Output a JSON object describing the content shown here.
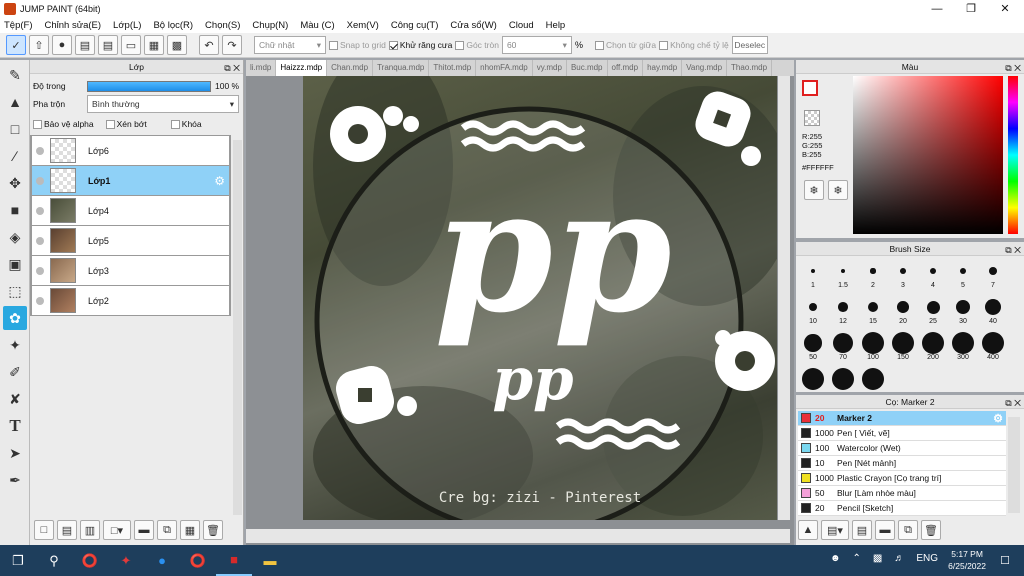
{
  "window": {
    "title": "JUMP PAINT (64bit)"
  },
  "menu": [
    "Tệp(F)",
    "Chỉnh sửa(E)",
    "Lớp(L)",
    "Bộ lọc(R)",
    "Chọn(S)",
    "Chụp(N)",
    "Màu (C)",
    "Xem(V)",
    "Công cụ(T)",
    "Cửa sổ(W)",
    "Cloud",
    "Help"
  ],
  "toolbar": {
    "shape_select": "Chữ nhật",
    "snap_grid": "Snap to grid",
    "antialias": "Khử răng cưa",
    "round_corner": "Góc tròn",
    "round_value": "60",
    "percent": "%",
    "center_select": "Chọn từ giữa",
    "lock_ratio": "Không chế tỷ lệ",
    "deselect": "Deselec"
  },
  "layer_panel": {
    "title": "Lớp",
    "opacity_label": "Độ trong",
    "opacity_value": "100 %",
    "blend_label": "Pha trộn",
    "blend_value": "Bình thường",
    "protect_alpha": "Bảo vệ alpha",
    "clipping": "Xén bớt",
    "lock": "Khóa",
    "layers": [
      {
        "name": "Lớp6",
        "selected": false
      },
      {
        "name": "Lớp1",
        "selected": true
      },
      {
        "name": "Lớp4",
        "selected": false
      },
      {
        "name": "Lớp5",
        "selected": false
      },
      {
        "name": "Lớp3",
        "selected": false
      },
      {
        "name": "Lớp2",
        "selected": false
      }
    ]
  },
  "tabs": [
    "li.mdp",
    "Haizzz.mdp",
    "Chan.mdp",
    "Tranqua.mdp",
    "Thitot.mdp",
    "nhomFA.mdp",
    "vy.mdp",
    "Buc.mdp",
    "off.mdp",
    "hay.mdp",
    "Vang.mdp",
    "Thao.mdp"
  ],
  "active_tab": "Haizzz.mdp",
  "canvas": {
    "big_text": "pp",
    "small_text": "pp",
    "credit": "Cre bg: zizi - Pinterest"
  },
  "color_panel": {
    "title": "Màu",
    "r": "R:255",
    "g": "G:255",
    "b": "B:255",
    "hex": "#FFFFFF"
  },
  "brush_panel": {
    "title": "Brush Size",
    "sizes": [
      "1",
      "1.5",
      "2",
      "3",
      "4",
      "5",
      "7",
      "10",
      "12",
      "15",
      "20",
      "25",
      "30",
      "40",
      "50",
      "70",
      "100",
      "150",
      "200",
      "300",
      "400"
    ]
  },
  "marker_panel": {
    "title": "Cọ: Marker 2",
    "items": [
      {
        "size": "20",
        "name": "Marker 2",
        "color": "#e8303a",
        "selected": true
      },
      {
        "size": "1000",
        "name": "Pen [ Viết, vẽ]",
        "color": "#222222",
        "selected": false
      },
      {
        "size": "100",
        "name": "Watercolor (Wet)",
        "color": "#7ad8f0",
        "selected": false
      },
      {
        "size": "10",
        "name": "Pen [Nét mảnh]",
        "color": "#222222",
        "selected": false
      },
      {
        "size": "1000",
        "name": "Plastic Crayon [Cọ trang trí]",
        "color": "#f0e020",
        "selected": false
      },
      {
        "size": "50",
        "name": "Blur [Làm nhòe màu]",
        "color": "#f4a0d8",
        "selected": false
      },
      {
        "size": "20",
        "name": "Pencil [Sketch]",
        "color": "#222222",
        "selected": false
      }
    ]
  },
  "taskbar": {
    "lang": "ENG",
    "time": "5:17 PM",
    "date": "6/25/2022"
  }
}
